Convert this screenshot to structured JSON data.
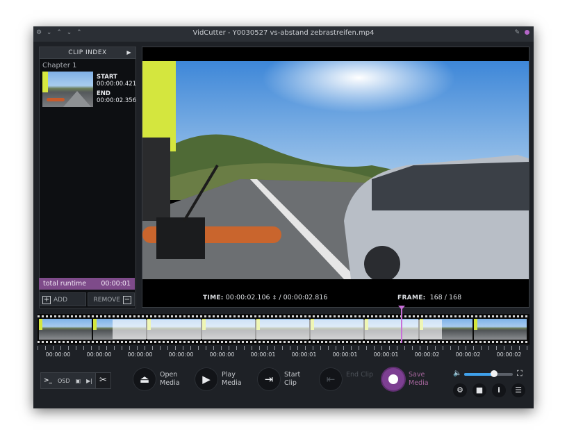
{
  "window": {
    "title": "VidCutter - Y0030527 vs-abstand zebrastreifen.mp4",
    "left_controls": "⚙ ⌄ ⌃ ⌄ ⌃",
    "right_controls": "✎"
  },
  "clip_index": {
    "header": "CLIP INDEX",
    "header_arrow": "▶",
    "chapter": "Chapter 1",
    "clips": [
      {
        "start_label": "START",
        "start": "00:00:00.421",
        "end_label": "END",
        "end": "00:00:02.356"
      }
    ],
    "runtime_label": "total runtime",
    "runtime_value": "00:00:01",
    "add_label": "ADD",
    "remove_label": "REMOVE"
  },
  "video_info": {
    "time_label": "TIME:",
    "time_current": "00:00:02.106",
    "time_separator": "/",
    "time_total": "00:00:02.816",
    "frame_label": "FRAME:",
    "frame_current": "168",
    "frame_separator": "/",
    "frame_total": "168"
  },
  "timeline": {
    "tick_labels": [
      "00:00:00",
      "00:00:00",
      "00:00:00",
      "00:00:00",
      "00:00:00",
      "00:00:01",
      "00:00:01",
      "00:00:01",
      "00:00:01",
      "00:00:02",
      "00:00:02",
      "00:00:02"
    ],
    "playhead_fraction": 0.745
  },
  "toolbar": {
    "console_label": ">_",
    "osd_label": "OSD",
    "open_label": "Open Media",
    "play_label": "Play Media",
    "start_clip_label": "Start Clip",
    "end_clip_label": "End Clip",
    "save_label": "Save Media",
    "volume_fraction": 0.62
  },
  "colors": {
    "accent": "#7e4b8a",
    "playhead": "#c86fd8",
    "volume": "#3fa0ea"
  }
}
